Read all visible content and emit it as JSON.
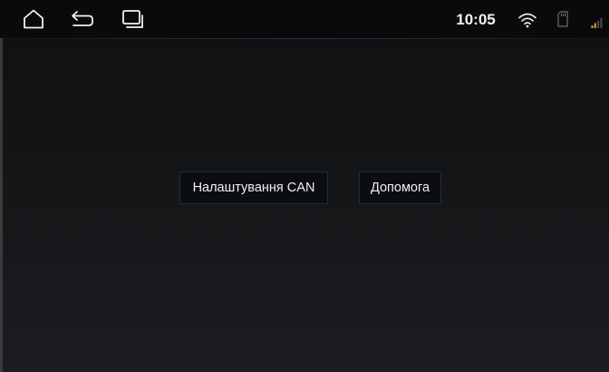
{
  "status_bar": {
    "time": "10:05",
    "icons": {
      "home": "home-icon",
      "back": "back-icon",
      "recents": "recent-apps-icon",
      "wifi": "wifi-icon",
      "sd_card": "sd-card-icon",
      "signal": "cellular-signal-icon"
    }
  },
  "main": {
    "buttons": [
      {
        "label": "Налаштування CAN"
      },
      {
        "label": "Допомога"
      }
    ]
  },
  "colors": {
    "status_bar_bg": "#0a0a0b",
    "signal_accent": "#e0a030",
    "button_border": "#1f2b45"
  }
}
